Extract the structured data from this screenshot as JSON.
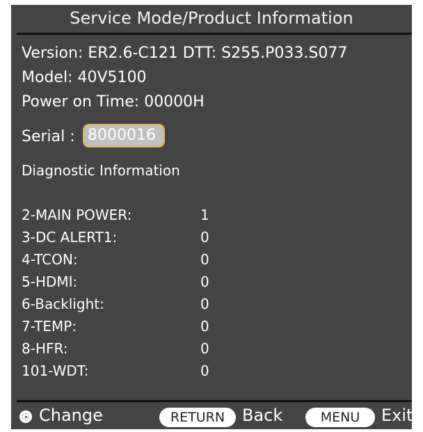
{
  "title": "Service Mode/Product Information",
  "info": {
    "version": "Version: ER2.6-C121  DTT: S255.P033.S077",
    "model": "Model: 40V5100",
    "power_on_time": "Power on Time: 00000H",
    "serial_label": "Serial :",
    "serial_value": "8000016"
  },
  "diagnostic": {
    "heading": "Diagnostic Information",
    "rows": [
      {
        "name": "2-MAIN POWER:",
        "value": "1"
      },
      {
        "name": "3-DC ALERT1:",
        "value": "0"
      },
      {
        "name": "4-TCON:",
        "value": "0"
      },
      {
        "name": "5-HDMI:",
        "value": "0"
      },
      {
        "name": "6-Backlight:",
        "value": "0"
      },
      {
        "name": "7-TEMP:",
        "value": "0"
      },
      {
        "name": "8-HFR:",
        "value": "0"
      },
      {
        "name": "101-WDT:",
        "value": "0"
      }
    ]
  },
  "footer": {
    "change_label": "Change",
    "return_key": "RETURN",
    "back_label": "Back",
    "menu_key": "MENU",
    "exit_label": "Exit"
  },
  "colors": {
    "background": "#444445",
    "serial_highlight_border": "#e5b44a",
    "serial_highlight_fill": "#bfc0c1"
  }
}
